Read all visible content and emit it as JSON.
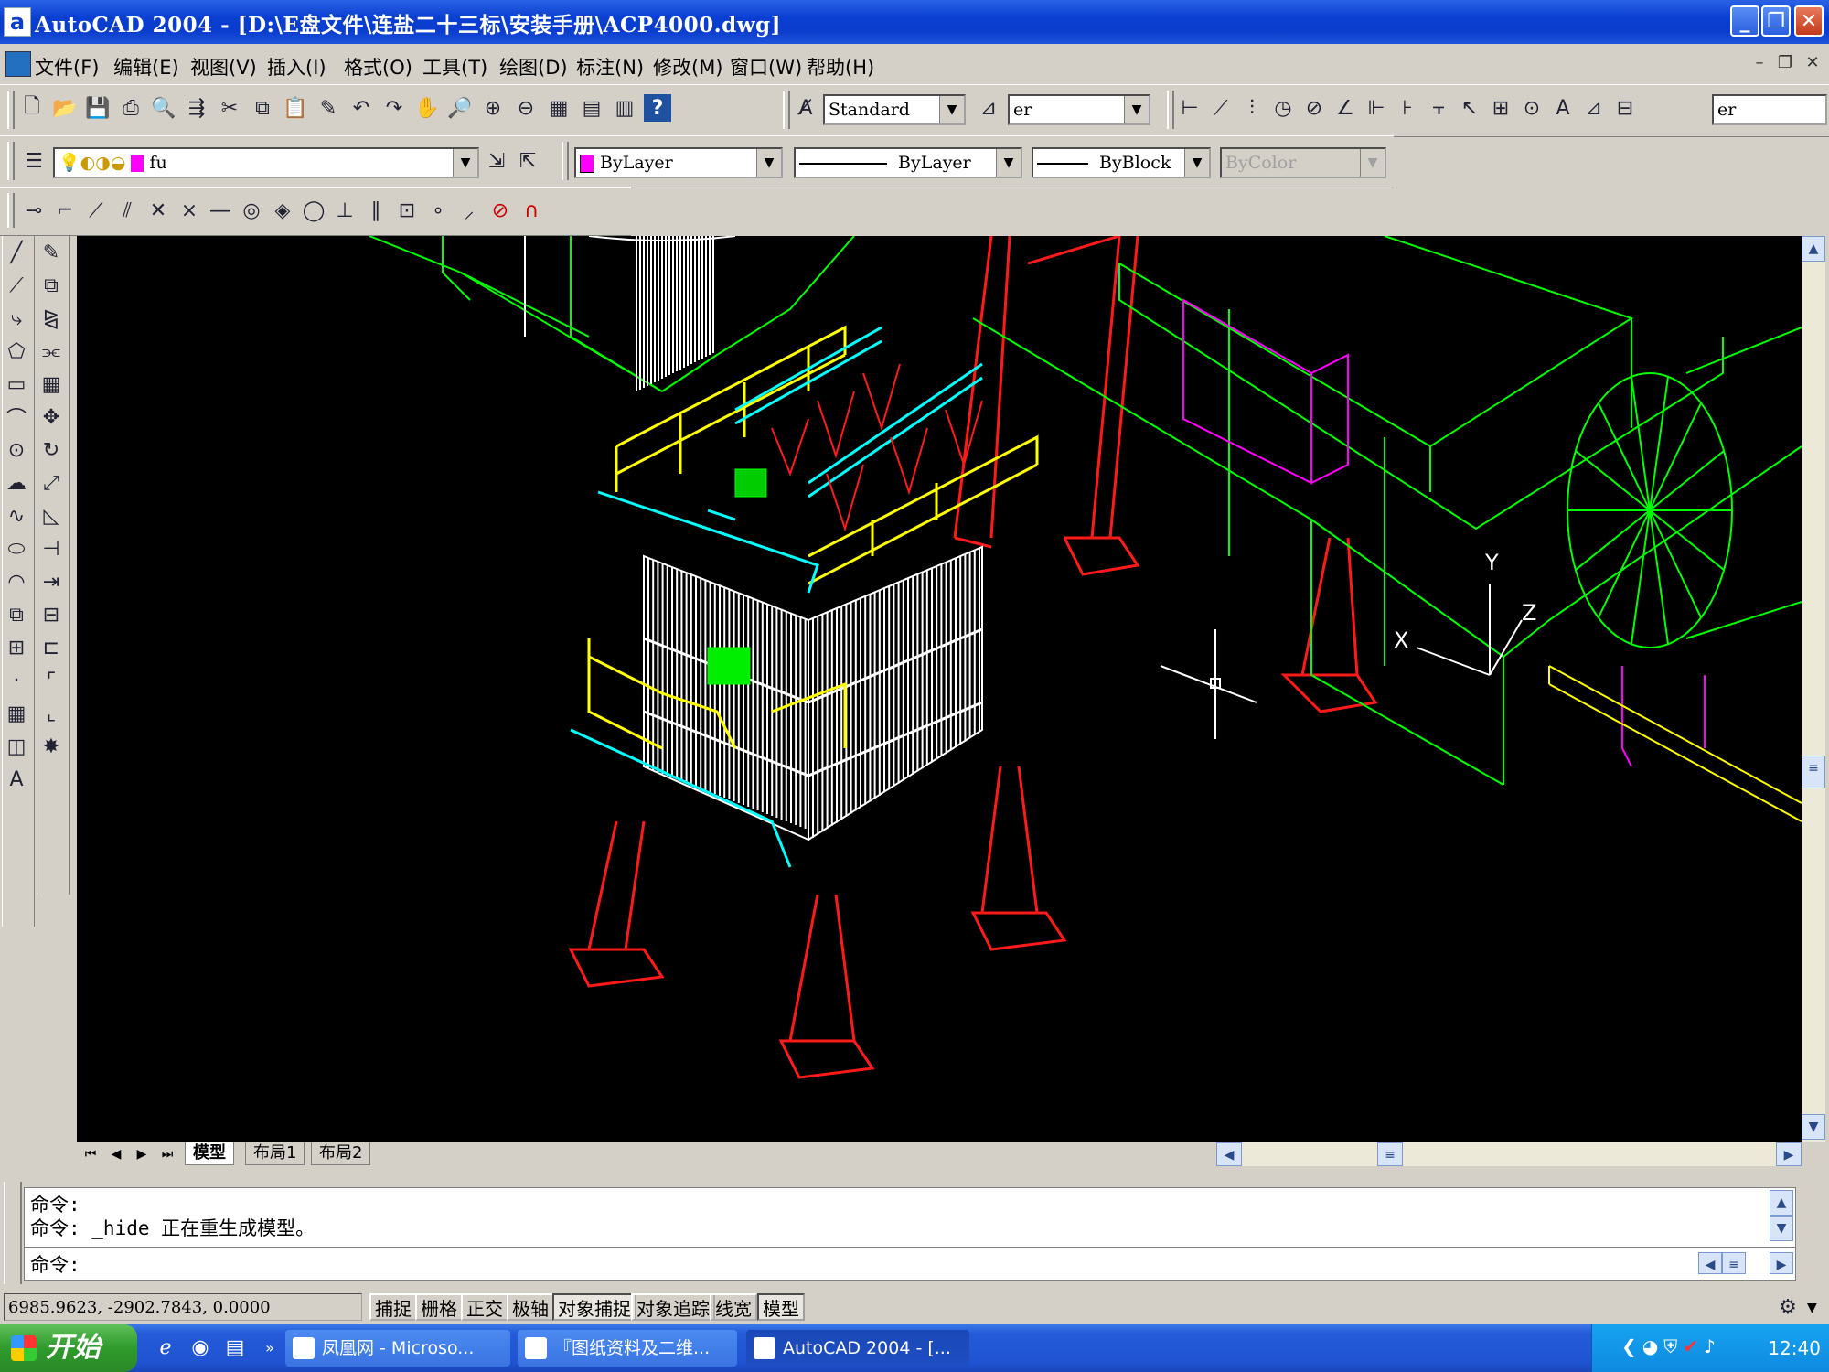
{
  "window": {
    "title": "AutoCAD 2004 - [D:\\E盘文件\\连盐二十三标\\安装手册\\ACP4000.dwg]",
    "app_icon": "a"
  },
  "menu": [
    "文件(F)",
    "编辑(E)",
    "视图(V)",
    "插入(I)",
    "格式(O)",
    "工具(T)",
    "绘图(D)",
    "标注(N)",
    "修改(M)",
    "窗口(W)",
    "帮助(H)"
  ],
  "toolbar": {
    "text_style": "Standard",
    "dim_style": "er",
    "dim_style_right": "er",
    "layer": "fu",
    "color": "ByLayer",
    "linetype": "ByLayer",
    "lineweight": "ByBlock",
    "plot_style": "ByColor"
  },
  "layout_tabs": [
    "模型",
    "布局1",
    "布局2"
  ],
  "ucs": {
    "x": "X",
    "y": "Y",
    "z": "Z"
  },
  "command": {
    "line1": "命令:",
    "line2": "命令: _hide 正在重生成模型。",
    "prompt": "命令:"
  },
  "status": {
    "coords": "6985.9623,  -2902.7843,  0.0000",
    "buttons": [
      {
        "label": "捕捉",
        "on": false
      },
      {
        "label": "栅格",
        "on": false
      },
      {
        "label": "正交",
        "on": false
      },
      {
        "label": "极轴",
        "on": false
      },
      {
        "label": "对象捕捉",
        "on": true
      },
      {
        "label": "对象追踪",
        "on": false
      },
      {
        "label": "线宽",
        "on": false
      },
      {
        "label": "模型",
        "on": true
      }
    ]
  },
  "taskbar": {
    "start": "开始",
    "tasks": [
      "凤凰网 - Microso...",
      "『图纸资料及二维...",
      "AutoCAD 2004 - [..."
    ],
    "clock": "12:40"
  },
  "colors": {
    "canvas": "#000000",
    "red": "#ff1a1a",
    "yellow": "#ffff00",
    "cyan": "#00ffff",
    "green": "#00ff00",
    "magenta": "#ff00ff",
    "white": "#ffffff",
    "titlebar": "#0a3fd1"
  }
}
